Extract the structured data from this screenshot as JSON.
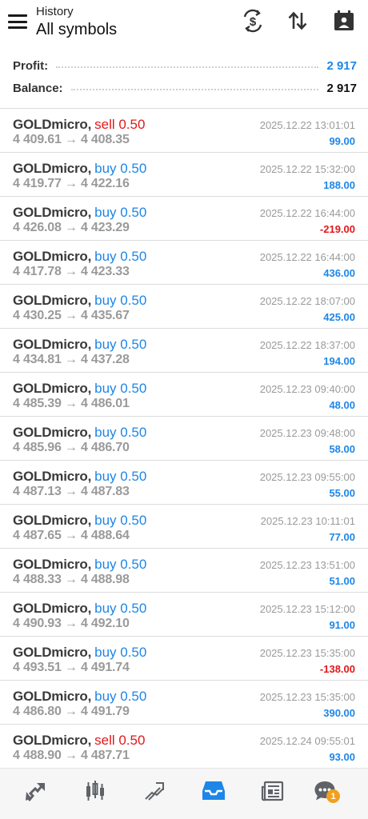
{
  "header": {
    "subtitle": "History",
    "title": "All symbols"
  },
  "icons": {
    "menu": "menu-icon",
    "currency": "currency-exchange-icon",
    "sort": "sort-icon",
    "calendar": "calendar-icon"
  },
  "summary": {
    "profit_label": "Profit:",
    "profit_value": "2 917",
    "balance_label": "Balance:",
    "balance_value": "2 917"
  },
  "colors": {
    "sell": "#e0191b",
    "buy": "#1e86e8",
    "profit_positive": "#1e86e8",
    "profit_negative": "#e0191b"
  },
  "trades": [
    {
      "symbol": "GOLDmicro,",
      "side": "sell 0.50",
      "type": "sell",
      "prices": "4 409.61 → 4 408.35",
      "datetime": "2025.12.22 13:01:01",
      "profit": "99.00",
      "sign": "pos"
    },
    {
      "symbol": "GOLDmicro,",
      "side": "buy 0.50",
      "type": "buy",
      "prices": "4 419.77 → 4 422.16",
      "datetime": "2025.12.22 15:32:00",
      "profit": "188.00",
      "sign": "pos"
    },
    {
      "symbol": "GOLDmicro,",
      "side": "buy 0.50",
      "type": "buy",
      "prices": "4 426.08 → 4 423.29",
      "datetime": "2025.12.22 16:44:00",
      "profit": "-219.00",
      "sign": "neg"
    },
    {
      "symbol": "GOLDmicro,",
      "side": "buy 0.50",
      "type": "buy",
      "prices": "4 417.78 → 4 423.33",
      "datetime": "2025.12.22 16:44:00",
      "profit": "436.00",
      "sign": "pos"
    },
    {
      "symbol": "GOLDmicro,",
      "side": "buy 0.50",
      "type": "buy",
      "prices": "4 430.25 → 4 435.67",
      "datetime": "2025.12.22 18:07:00",
      "profit": "425.00",
      "sign": "pos"
    },
    {
      "symbol": "GOLDmicro,",
      "side": "buy 0.50",
      "type": "buy",
      "prices": "4 434.81 → 4 437.28",
      "datetime": "2025.12.22 18:37:00",
      "profit": "194.00",
      "sign": "pos"
    },
    {
      "symbol": "GOLDmicro,",
      "side": "buy 0.50",
      "type": "buy",
      "prices": "4 485.39 → 4 486.01",
      "datetime": "2025.12.23 09:40:00",
      "profit": "48.00",
      "sign": "pos"
    },
    {
      "symbol": "GOLDmicro,",
      "side": "buy 0.50",
      "type": "buy",
      "prices": "4 485.96 → 4 486.70",
      "datetime": "2025.12.23 09:48:00",
      "profit": "58.00",
      "sign": "pos"
    },
    {
      "symbol": "GOLDmicro,",
      "side": "buy 0.50",
      "type": "buy",
      "prices": "4 487.13 → 4 487.83",
      "datetime": "2025.12.23 09:55:00",
      "profit": "55.00",
      "sign": "pos"
    },
    {
      "symbol": "GOLDmicro,",
      "side": "buy 0.50",
      "type": "buy",
      "prices": "4 487.65 → 4 488.64",
      "datetime": "2025.12.23 10:11:01",
      "profit": "77.00",
      "sign": "pos"
    },
    {
      "symbol": "GOLDmicro,",
      "side": "buy 0.50",
      "type": "buy",
      "prices": "4 488.33 → 4 488.98",
      "datetime": "2025.12.23 13:51:00",
      "profit": "51.00",
      "sign": "pos"
    },
    {
      "symbol": "GOLDmicro,",
      "side": "buy 0.50",
      "type": "buy",
      "prices": "4 490.93 → 4 492.10",
      "datetime": "2025.12.23 15:12:00",
      "profit": "91.00",
      "sign": "pos"
    },
    {
      "symbol": "GOLDmicro,",
      "side": "buy 0.50",
      "type": "buy",
      "prices": "4 493.51 → 4 491.74",
      "datetime": "2025.12.23 15:35:00",
      "profit": "-138.00",
      "sign": "neg"
    },
    {
      "symbol": "GOLDmicro,",
      "side": "buy 0.50",
      "type": "buy",
      "prices": "4 486.80 → 4 491.79",
      "datetime": "2025.12.23 15:35:00",
      "profit": "390.00",
      "sign": "pos"
    },
    {
      "symbol": "GOLDmicro,",
      "side": "sell 0.50",
      "type": "sell",
      "prices": "4 488.90 → 4 487.71",
      "datetime": "2025.12.24 09:55:01",
      "profit": "93.00",
      "sign": "pos"
    }
  ],
  "bottom_nav": {
    "items": [
      {
        "icon": "quotes-icon",
        "active": false
      },
      {
        "icon": "chart-icon",
        "active": false
      },
      {
        "icon": "trade-icon",
        "active": false
      },
      {
        "icon": "history-icon",
        "active": true
      },
      {
        "icon": "news-icon",
        "active": false
      },
      {
        "icon": "messages-icon",
        "active": false
      }
    ],
    "messages_badge": "1"
  }
}
